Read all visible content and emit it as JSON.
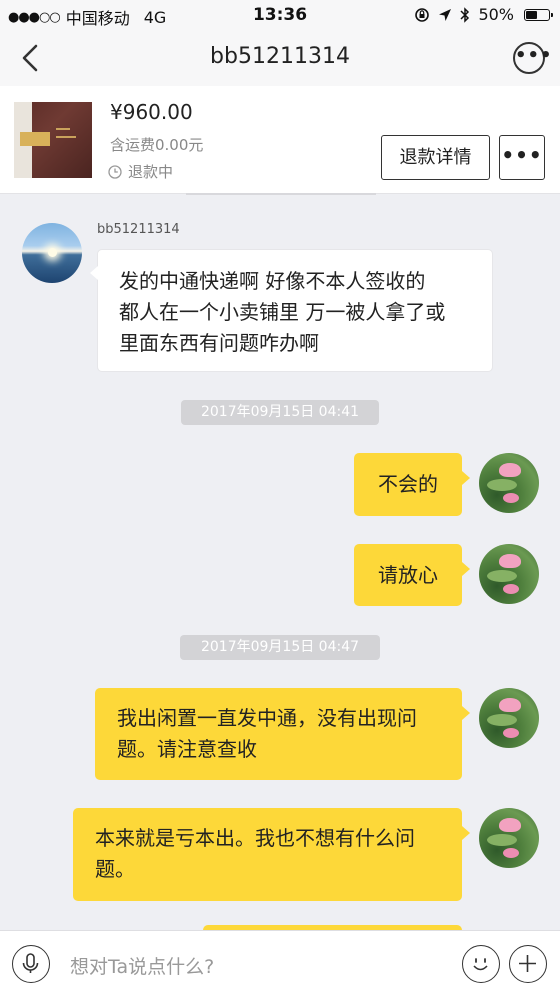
{
  "status_bar": {
    "signal": "●●●○○",
    "carrier": "中国移动",
    "network": "4G",
    "time": "13:36",
    "battery": "50%"
  },
  "nav": {
    "title": "bb51211314"
  },
  "product": {
    "price": "¥960.00",
    "shipping": "含运费0.00元",
    "status": "退款中",
    "refund_button": "退款详情",
    "more_button": "•••"
  },
  "messages": [
    {
      "side": "left",
      "sender": "bb51211314",
      "lines": [
        "发的中通快递啊 好像不本人签收的",
        "都人在一个小卖铺里 万一被人拿了或",
        "里面东西有问题咋办啊"
      ]
    },
    {
      "time": "2017年09月15日  04:41"
    },
    {
      "side": "right",
      "lines": [
        "不会的"
      ]
    },
    {
      "side": "right",
      "lines": [
        "请放心"
      ]
    },
    {
      "time": "2017年09月15日  04:47"
    },
    {
      "side": "right",
      "lines": [
        "我出闲置一直发中通，没有出现问",
        "题。请注意查收"
      ]
    },
    {
      "side": "right",
      "lines": [
        "本来就是亏本出。我也不想有什么问",
        "题。"
      ]
    }
  ],
  "input": {
    "placeholder": "想对Ta说点什么?"
  },
  "colors": {
    "bubble_right": "#fdd839",
    "bubble_left": "#ffffff",
    "background": "#eeeff3"
  }
}
